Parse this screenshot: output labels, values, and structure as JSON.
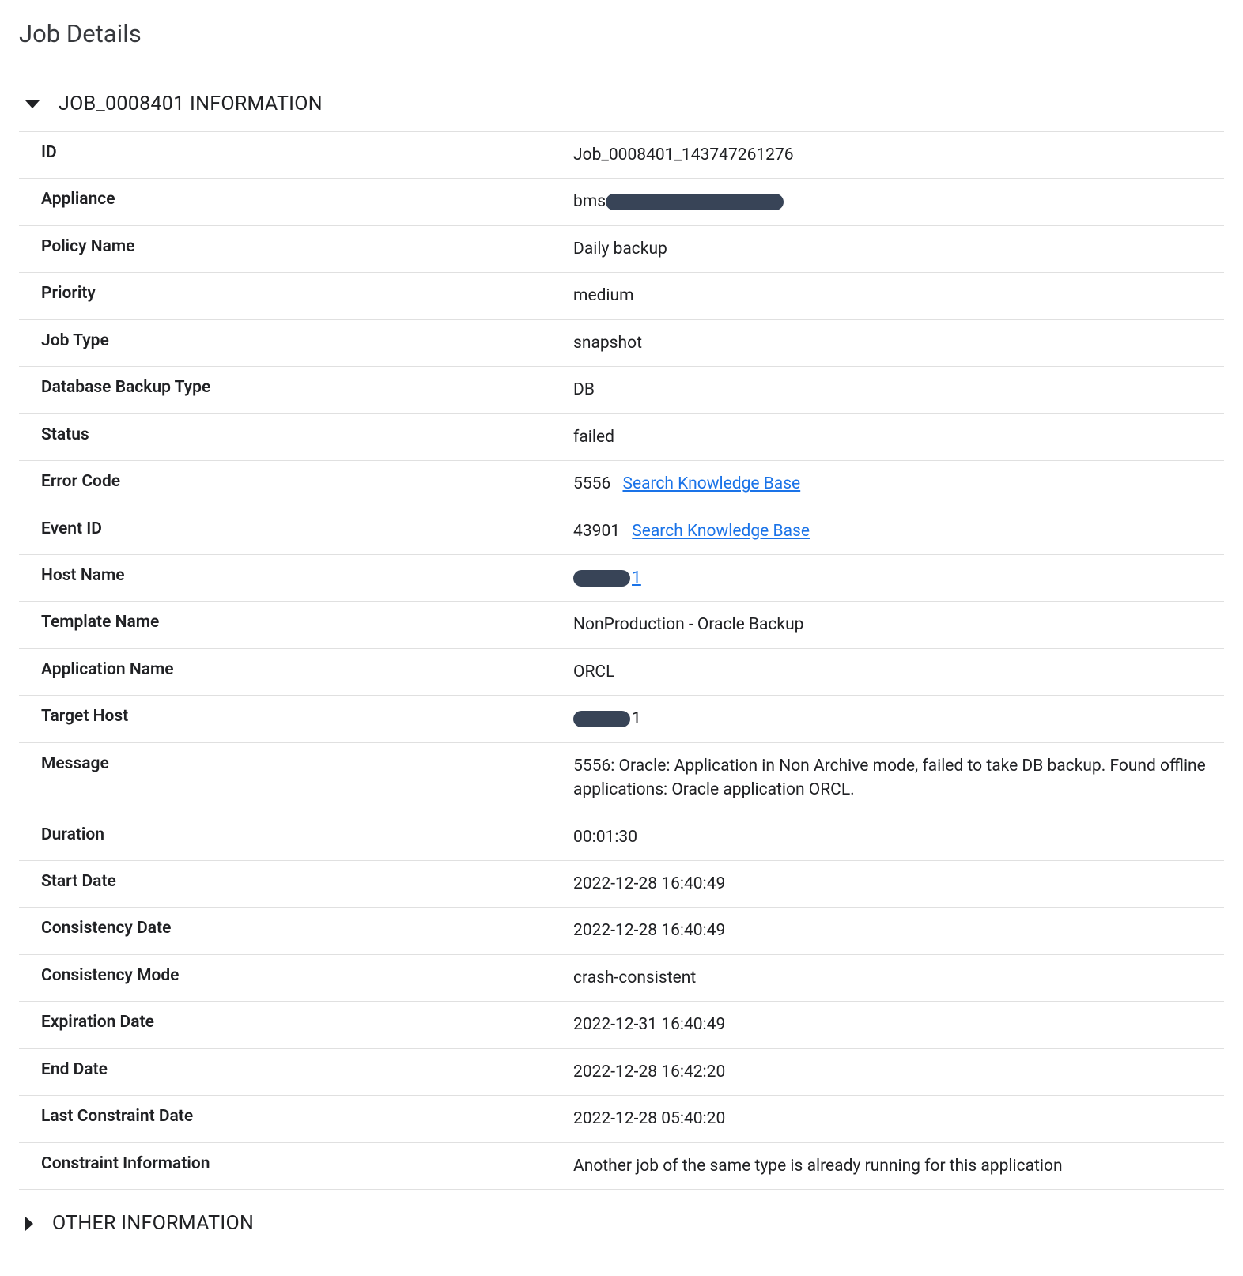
{
  "page_title": "Job Details",
  "sections": {
    "info": {
      "title": "JOB_0008401 INFORMATION",
      "expanded": true,
      "rows": {
        "id": {
          "label": "ID",
          "value": "Job_0008401_143747261276"
        },
        "appliance": {
          "label": "Appliance",
          "value_prefix": "bms"
        },
        "policy_name": {
          "label": "Policy Name",
          "value": "Daily backup"
        },
        "priority": {
          "label": "Priority",
          "value": "medium"
        },
        "job_type": {
          "label": "Job Type",
          "value": "snapshot"
        },
        "db_backup_type": {
          "label": "Database Backup Type",
          "value": "DB"
        },
        "status": {
          "label": "Status",
          "value": "failed"
        },
        "error_code": {
          "label": "Error Code",
          "value": "5556",
          "link_text": "Search Knowledge Base"
        },
        "event_id": {
          "label": "Event ID",
          "value": "43901",
          "link_text": "Search Knowledge Base"
        },
        "host_name": {
          "label": "Host Name",
          "value_suffix": "1"
        },
        "template_name": {
          "label": "Template Name",
          "value": "NonProduction - Oracle Backup"
        },
        "application_name": {
          "label": "Application Name",
          "value": "ORCL"
        },
        "target_host": {
          "label": "Target Host",
          "value_suffix": "1"
        },
        "message": {
          "label": "Message",
          "value": "5556: Oracle: Application in Non Archive mode, failed to take DB backup. Found offline applications: Oracle application ORCL."
        },
        "duration": {
          "label": "Duration",
          "value": "00:01:30"
        },
        "start_date": {
          "label": "Start Date",
          "value": "2022-12-28 16:40:49"
        },
        "consistency_date": {
          "label": "Consistency Date",
          "value": "2022-12-28 16:40:49"
        },
        "consistency_mode": {
          "label": "Consistency Mode",
          "value": "crash-consistent"
        },
        "expiration_date": {
          "label": "Expiration Date",
          "value": "2022-12-31 16:40:49"
        },
        "end_date": {
          "label": "End Date",
          "value": "2022-12-28 16:42:20"
        },
        "last_constraint_date": {
          "label": "Last Constraint Date",
          "value": "2022-12-28 05:40:20"
        },
        "constraint_info": {
          "label": "Constraint Information",
          "value": "Another job of the same type is already running for this application"
        }
      }
    },
    "other": {
      "title": "OTHER INFORMATION",
      "expanded": false
    }
  }
}
